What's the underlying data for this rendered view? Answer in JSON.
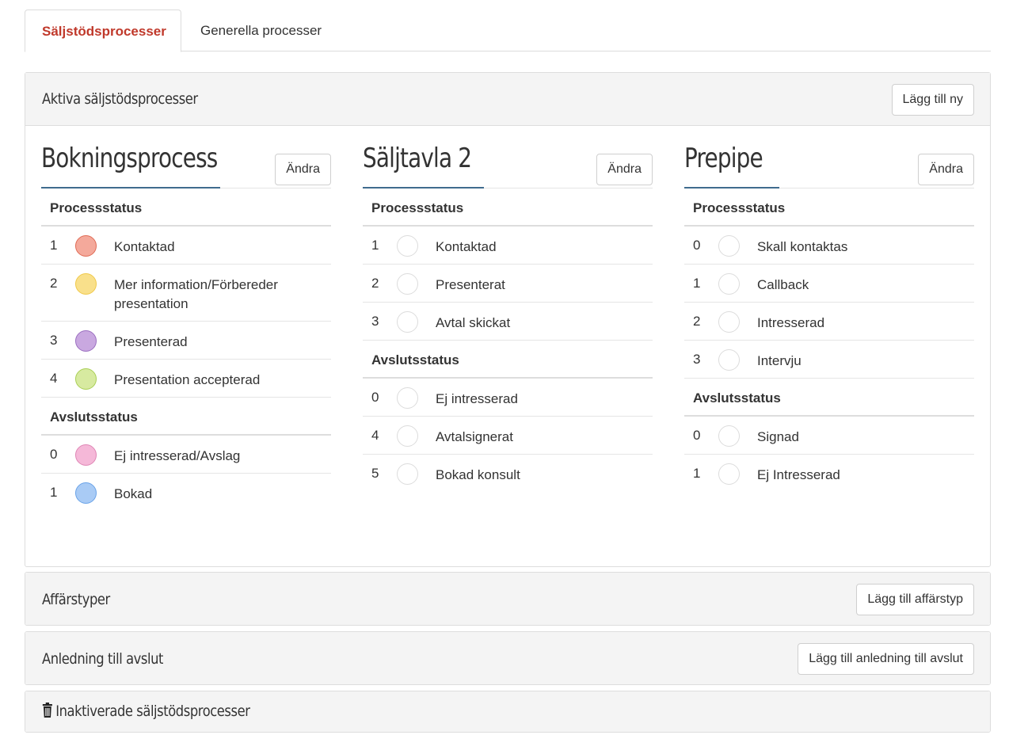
{
  "tabs": [
    {
      "label": "Säljstödsprocesser",
      "active": true
    },
    {
      "label": "Generella processer",
      "active": false
    }
  ],
  "active_panel": {
    "title": "Aktiva säljstödsprocesser",
    "add_button": "Lägg till ny"
  },
  "processes": [
    {
      "title": "Bokningsprocess",
      "edit_label": "Ändra",
      "process_label": "Processstatus",
      "process_status": [
        {
          "num": "1",
          "label": "Kontaktad",
          "color": "#f4a99b",
          "border": "#e06b55"
        },
        {
          "num": "2",
          "label": "Mer information/Förbereder presentation",
          "color": "#f9e08b",
          "border": "#f0c94a"
        },
        {
          "num": "3",
          "label": "Presenterad",
          "color": "#c9a8e0",
          "border": "#9b6fc0"
        },
        {
          "num": "4",
          "label": "Presentation accepterad",
          "color": "#d7eaa0",
          "border": "#a9cf55"
        }
      ],
      "close_label": "Avslutsstatus",
      "close_status": [
        {
          "num": "0",
          "label": "Ej intresserad/Avslag",
          "color": "#f5b8d8",
          "border": "#df86b5"
        },
        {
          "num": "1",
          "label": "Bokad",
          "color": "#a9cbf5",
          "border": "#6aa3e8"
        }
      ]
    },
    {
      "title": "Säljtavla 2",
      "edit_label": "Ändra",
      "process_label": "Processstatus",
      "process_status": [
        {
          "num": "1",
          "label": "Kontaktad"
        },
        {
          "num": "2",
          "label": "Presenterat"
        },
        {
          "num": "3",
          "label": "Avtal skickat"
        }
      ],
      "close_label": "Avslutsstatus",
      "close_status": [
        {
          "num": "0",
          "label": "Ej intresserad"
        },
        {
          "num": "4",
          "label": "Avtalsignerat"
        },
        {
          "num": "5",
          "label": "Bokad konsult"
        }
      ]
    },
    {
      "title": "Prepipe",
      "edit_label": "Ändra",
      "process_label": "Processstatus",
      "process_status": [
        {
          "num": "0",
          "label": "Skall kontaktas"
        },
        {
          "num": "1",
          "label": "Callback"
        },
        {
          "num": "2",
          "label": "Intresserad"
        },
        {
          "num": "3",
          "label": "Intervju"
        }
      ],
      "close_label": "Avslutsstatus",
      "close_status": [
        {
          "num": "0",
          "label": "Signad"
        },
        {
          "num": "1",
          "label": "Ej Intresserad"
        }
      ]
    }
  ],
  "affarstyper": {
    "title": "Affärstyper",
    "add_button": "Lägg till affärstyp"
  },
  "anledning": {
    "title": "Anledning till avslut",
    "add_button": "Lägg till anledning till avslut"
  },
  "inaktiverade": {
    "title": "Inaktiverade säljstödsprocesser",
    "icon": "trash-icon"
  },
  "colors": {
    "accent": "#c0392b",
    "underline": "#3f6c8e",
    "panel_bg": "#f4f4f4"
  }
}
